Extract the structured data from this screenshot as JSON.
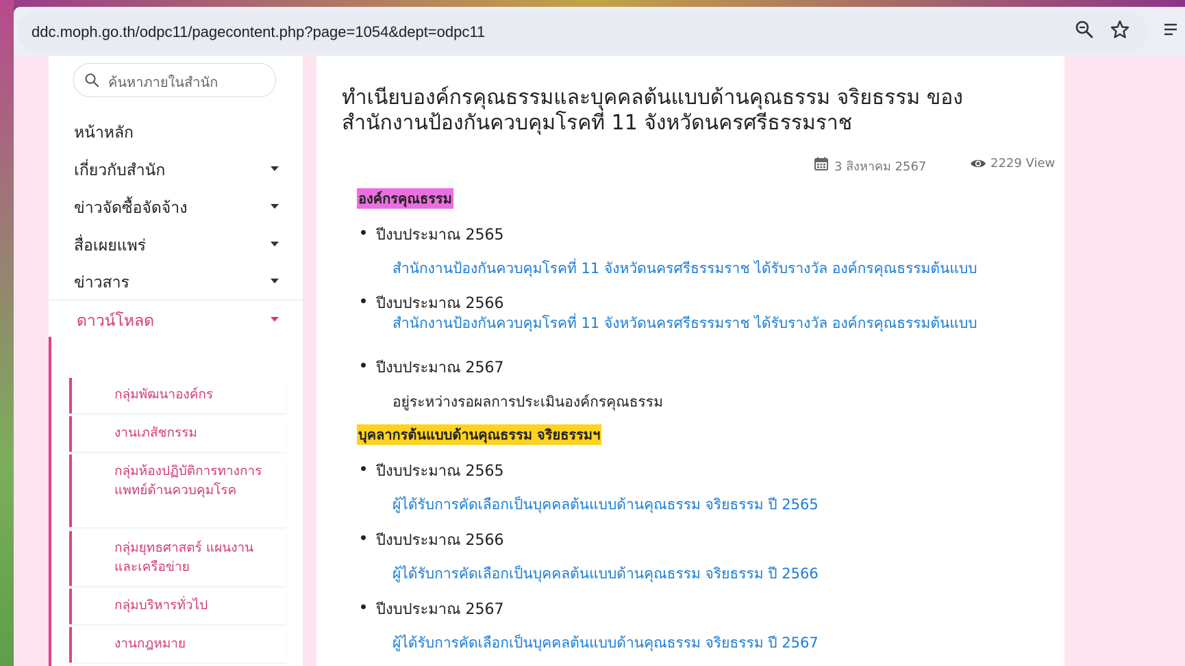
{
  "browser": {
    "url": "ddc.moph.go.th/odpc11/pagecontent.php?page=1054&dept=odpc11"
  },
  "sidebar": {
    "search_placeholder": "ค้นหาภายในสำนัก",
    "items": [
      {
        "label": "หน้าหลัก",
        "has_submenu": false
      },
      {
        "label": "เกี่ยวกับสำนัก",
        "has_submenu": true
      },
      {
        "label": "ข่าวจัดซื้อจัดจ้าง",
        "has_submenu": true
      },
      {
        "label": "สื่อเผยแพร่",
        "has_submenu": true
      },
      {
        "label": "ข่าวสาร",
        "has_submenu": true
      },
      {
        "label": "ดาวน์โหลด",
        "has_submenu": true,
        "active": true
      }
    ],
    "subitems": [
      "กลุ่มพัฒนาองค์กร",
      "งานเภสัชกรรม",
      "กลุ่มห้องปฏิบัติการทางการแพทย์ด้านควบคุมโรค",
      "กลุ่มยุทธศาสตร์ แผนงาน และเครือข่าย",
      "กลุ่มบริหารทั่วไป",
      "งานกฎหมาย"
    ],
    "accent_color": "#d33b7a"
  },
  "article": {
    "title": "ทำเนียบองค์กรคุณธรรมและบุคคลต้นแบบด้านคุณธรรม จริยธรรม ของสำนักงานป้องกันควบคุมโรคที่ 11 จังหวัดนครศรีธรรมราช",
    "date": "3 สิงหาคม 2567",
    "views": "2229 View",
    "section1": {
      "heading": "องค์กรคุณธรรม",
      "highlight_color": "#ec6fe0",
      "entries": [
        {
          "year": "ปีงบประมาณ 2565",
          "link": "สำนักงานป้องกันควบคุมโรคที่ 11 จังหวัดนครศรีธรรมราช ได้รับรางวัล องค์กรคุณธรรมต้นแบบ"
        },
        {
          "year": "ปีงบประมาณ 2566",
          "link": "สำนักงานป้องกันควบคุมโรคที่ 11 จังหวัดนครศรีธรรมราช ได้รับรางวัล องค์กรคุณธรรมต้นแบบ"
        },
        {
          "year": "ปีงบประมาณ 2567",
          "text": "อยู่ระหว่างรอผลการประเมินองค์กรคุณธรรม"
        }
      ]
    },
    "section2": {
      "heading": "บุคลากรต้นแบบด้านคุณธรรม จริยธรรมฯ",
      "highlight_color": "#ffd21f",
      "entries": [
        {
          "year": "ปีงบประมาณ 2565",
          "link": "ผู้ได้รับการคัดเลือกเป็นบุคคลต้นแบบด้านคุณธรรม จริยธรรม ปี 2565"
        },
        {
          "year": "ปีงบประมาณ 2566",
          "link": "ผู้ได้รับการคัดเลือกเป็นบุคคลต้นแบบด้านคุณธรรม จริยธรรม ปี 2566"
        },
        {
          "year": "ปีงบประมาณ 2567",
          "link": "ผู้ได้รับการคัดเลือกเป็นบุคคลต้นแบบด้านคุณธรรม จริยธรรม ปี 2567"
        }
      ]
    },
    "link_color": "#1a7dd6"
  }
}
